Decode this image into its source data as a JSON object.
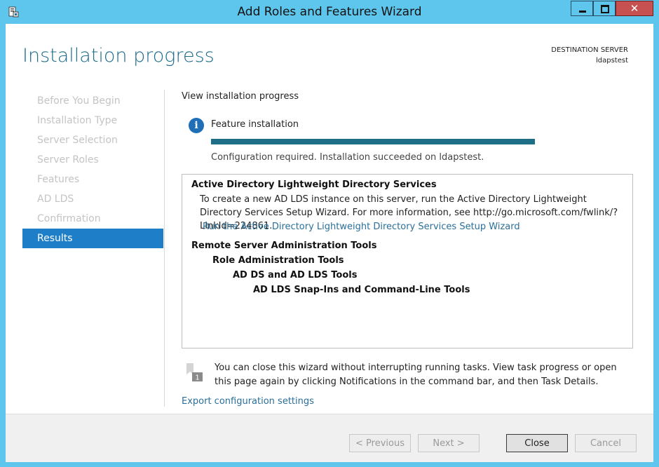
{
  "window": {
    "title": "Add Roles and Features Wizard"
  },
  "header": {
    "page_title": "Installation progress",
    "destination_label": "DESTINATION SERVER",
    "destination_server": "ldapstest"
  },
  "nav": {
    "items": [
      {
        "label": "Before You Begin"
      },
      {
        "label": "Installation Type"
      },
      {
        "label": "Server Selection"
      },
      {
        "label": "Server Roles"
      },
      {
        "label": "Features"
      },
      {
        "label": "AD LDS"
      },
      {
        "label": "Confirmation"
      },
      {
        "label": "Results"
      }
    ],
    "active": "Results"
  },
  "main": {
    "view_label": "View installation progress",
    "feature_label": "Feature installation",
    "progress_percent": 100,
    "status_text": "Configuration required. Installation succeeded on ldapstest.",
    "results": {
      "ad_title": "Active Directory Lightweight Directory Services",
      "ad_desc": "To create a new AD LDS instance on this server, run the Active Directory Lightweight Directory Services Setup Wizard. For more information, see http://go.microsoft.com/fwlink/?LinkId=224861.",
      "ad_link": "Run the Active Directory Lightweight Directory Services Setup Wizard",
      "rsat": "Remote Server Administration Tools",
      "role_tools": "Role Administration Tools",
      "adds_tools": "AD DS and AD LDS Tools",
      "snapins": "AD LDS Snap-Ins and Command-Line Tools"
    },
    "note_text": "You can close this wizard without interrupting running tasks. View task progress or open this page again by clicking Notifications in the command bar, and then Task Details.",
    "export_link": "Export configuration settings"
  },
  "footer": {
    "previous": "< Previous",
    "next": "Next >",
    "close": "Close",
    "cancel": "Cancel"
  },
  "colors": {
    "titlebar": "#5ec6ec",
    "accent": "#1e7ec8",
    "progress": "#1f6e87",
    "link": "#2a6f9a"
  },
  "icons": {
    "app": "server-manager-icon",
    "info": "info-icon",
    "notification": "flag-icon"
  }
}
